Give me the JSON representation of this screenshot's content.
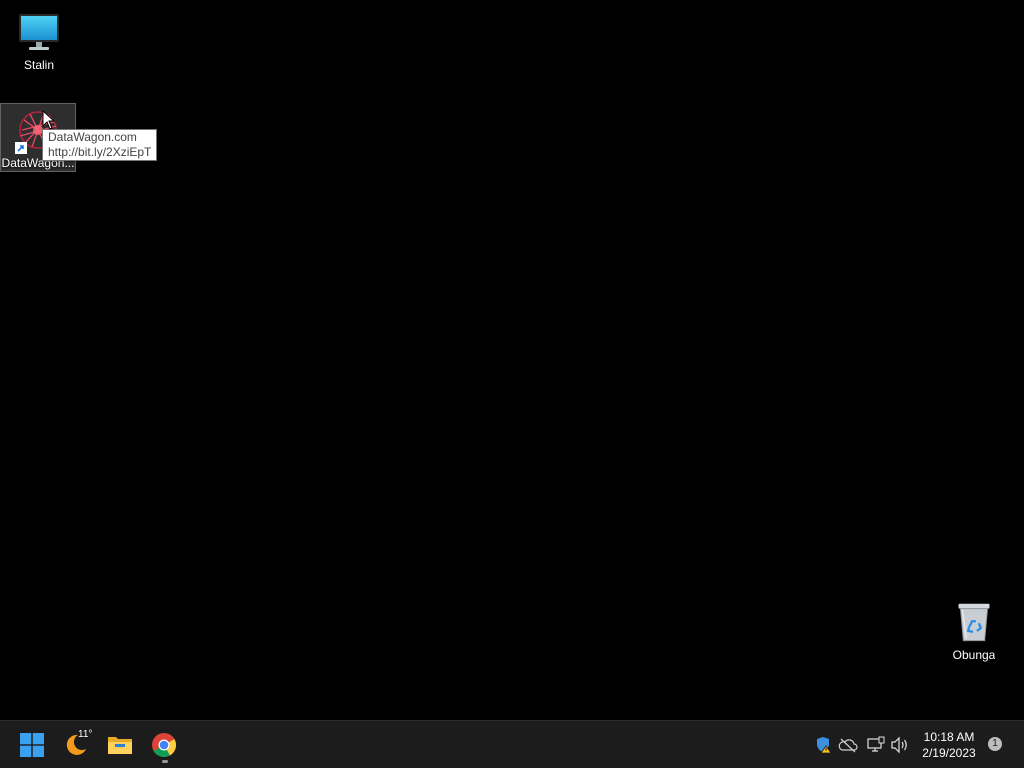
{
  "desktop": {
    "icons": [
      {
        "label": "Stalin",
        "icon": "monitor-icon"
      },
      {
        "label": "DataWagon...",
        "icon": "shortcut-icon"
      },
      {
        "label": "Obunga",
        "icon": "recycle-bin-icon"
      }
    ],
    "tooltip": {
      "line1": "DataWagon.com",
      "line2": "http://bit.ly/2XziEpT"
    }
  },
  "taskbar": {
    "weather_temp": "11°",
    "clock_time": "10:18 AM",
    "clock_date": "2/19/2023",
    "notification_count": "1",
    "apps": [
      "start-icon",
      "weather-icon",
      "file-explorer-icon",
      "chrome-icon"
    ],
    "tray": [
      "defender-icon",
      "onedrive-icon",
      "network-icon",
      "volume-icon"
    ]
  }
}
